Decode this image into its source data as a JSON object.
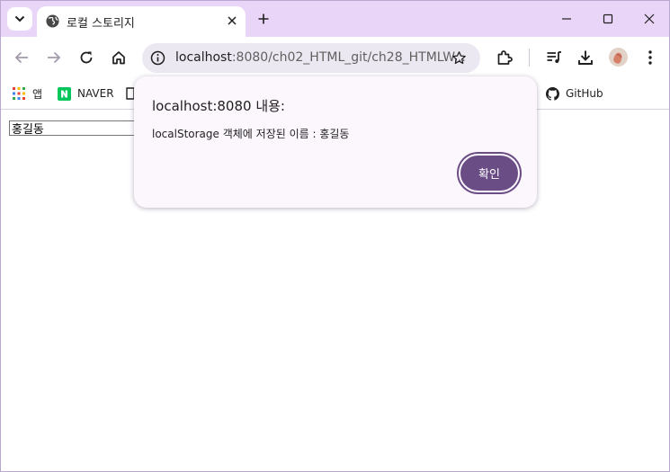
{
  "browser": {
    "tab": {
      "title": "로컬 스토리지",
      "favicon": "globe-icon"
    },
    "address_bar": {
      "host": "localhost",
      "rest": ":8080/ch02_HTML_git/ch28_HTMLW..."
    },
    "bookmarks": [
      {
        "label": "앱",
        "icon": "apps-grid-icon"
      },
      {
        "label": "NAVER",
        "icon": "naver-icon"
      },
      {
        "label": "GitHub",
        "icon": "github-icon"
      }
    ]
  },
  "page": {
    "name_input_value": "홍길동"
  },
  "dialog": {
    "title": "localhost:8080 내용:",
    "message": "localStorage 객체에 저장된 이름 : 홍길동",
    "ok_label": "확인",
    "accent_color": "#6b4d86"
  }
}
